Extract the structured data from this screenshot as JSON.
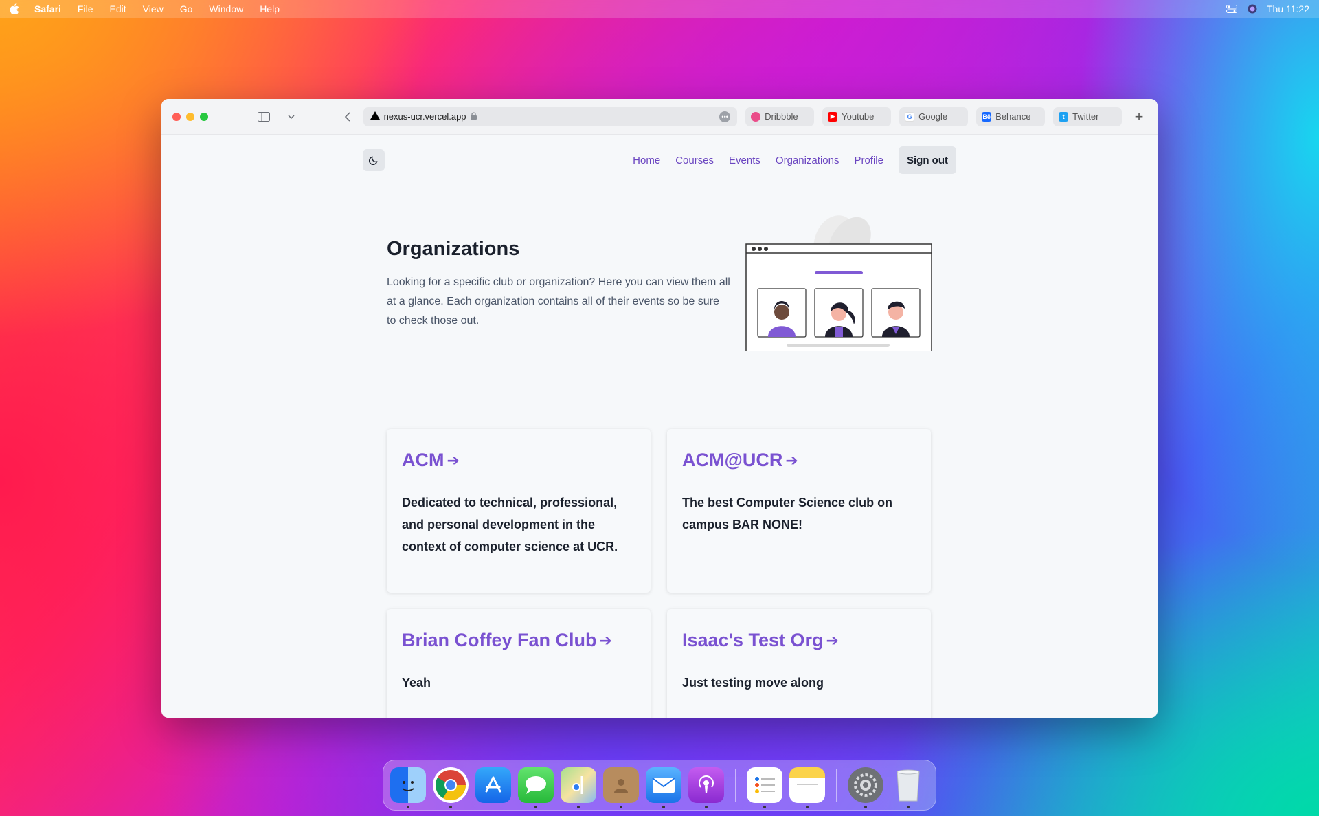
{
  "menubar": {
    "app": "Safari",
    "items": [
      "File",
      "Edit",
      "View",
      "Go",
      "Window",
      "Help"
    ],
    "clock": "Thu 11:22"
  },
  "browser": {
    "url": "nexus-ucr.vercel.app",
    "favorites": [
      {
        "label": "Dribbble",
        "icon": "dribbble-icon",
        "color": "#ea4c89"
      },
      {
        "label": "Youtube",
        "icon": "youtube-icon",
        "color": "#ff0000"
      },
      {
        "label": "Google",
        "icon": "google-icon",
        "color": "#4285f4"
      },
      {
        "label": "Behance",
        "icon": "behance-icon",
        "color": "#1769ff"
      },
      {
        "label": "Twitter",
        "icon": "twitter-icon",
        "color": "#1da1f2"
      }
    ]
  },
  "site": {
    "nav": [
      "Home",
      "Courses",
      "Events",
      "Organizations",
      "Profile"
    ],
    "signout": "Sign out",
    "accent": "#6b46c1"
  },
  "hero": {
    "title": "Organizations",
    "description": "Looking for a specific club or organization? Here you can view them all at a glance. Each organization contains all of their events so be sure to check those out."
  },
  "organizations": [
    {
      "name": "ACM",
      "description": "Dedicated to technical, professional, and personal development in the context of computer science at UCR."
    },
    {
      "name": "ACM@UCR",
      "description": "The best Computer Science club on campus BAR NONE!"
    },
    {
      "name": "Brian Coffey Fan Club",
      "description": "Yeah"
    },
    {
      "name": "Isaac's Test Org",
      "description": "Just testing move along"
    }
  ],
  "dock": [
    {
      "name": "finder",
      "color": "#3a8df5",
      "running": true
    },
    {
      "name": "chrome",
      "color": "#ffffff",
      "running": true
    },
    {
      "name": "app-store",
      "color": "#1e8cf5",
      "running": false
    },
    {
      "name": "messages",
      "color": "#2ecc4a",
      "running": true
    },
    {
      "name": "maps",
      "color": "#8fd16a",
      "running": true
    },
    {
      "name": "contacts",
      "color": "#b0885a",
      "running": true
    },
    {
      "name": "mail",
      "color": "#3a9cf5",
      "running": true
    },
    {
      "name": "podcasts",
      "color": "#a03ad6",
      "running": true
    },
    {
      "name": "reminders",
      "color": "#ffffff",
      "running": true
    },
    {
      "name": "notes",
      "color": "#fbd34a",
      "running": true
    },
    {
      "name": "system-preferences",
      "color": "#7a7d82",
      "running": true
    },
    {
      "name": "trash",
      "color": "#dfe3e8",
      "running": true
    }
  ]
}
